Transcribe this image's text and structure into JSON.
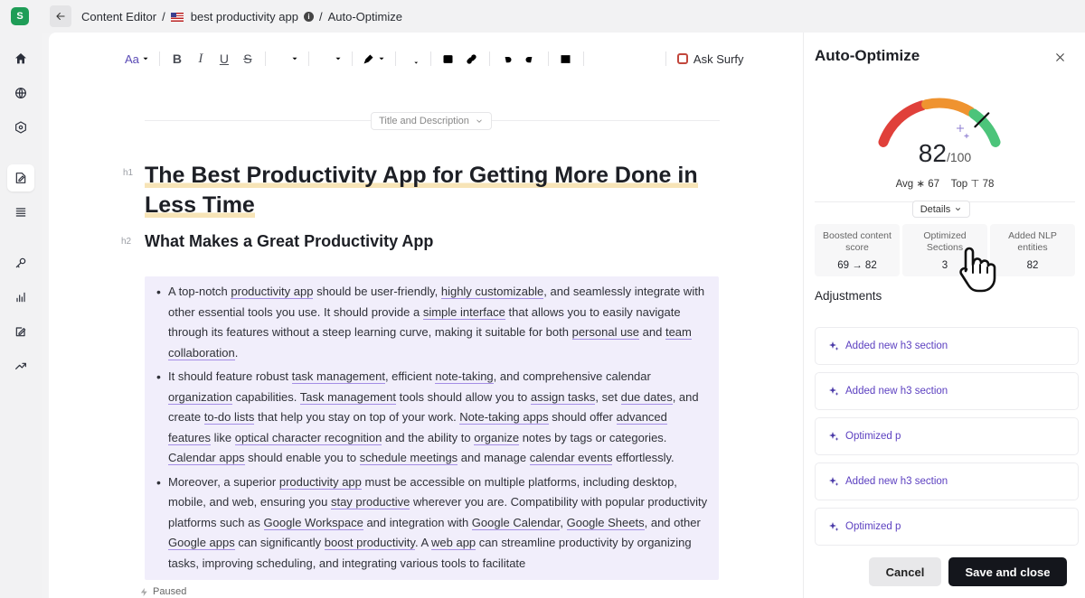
{
  "app": {
    "logo_letter": "S",
    "accent": "#1f9d57"
  },
  "breadcrumb": {
    "root": "Content Editor",
    "sep": "/",
    "doc": "best productivity app",
    "page": "Auto-Optimize"
  },
  "toolbar": {
    "text_style": "Aa",
    "ask_surfy": "Ask Surfy"
  },
  "editor": {
    "title_desc_button": "Title and Description",
    "h1_tag": "h1",
    "h1": "The Best Productivity App for Getting More Done in Less Time",
    "h2_tag": "h2",
    "h2": "What Makes a Great Productivity App",
    "status": "Paused",
    "bullets": [
      [
        {
          "t": "A top-notch "
        },
        {
          "t": "productivity app",
          "u": true
        },
        {
          "t": " should be user-friendly, "
        },
        {
          "t": "highly customizable",
          "u": true
        },
        {
          "t": ", and seamlessly integrate with other essential tools you use. It should provide a "
        },
        {
          "t": "simple interface",
          "u": true
        },
        {
          "t": " that allows you to easily navigate through its features without a steep learning curve, making it suitable for both "
        },
        {
          "t": "personal use",
          "u": true
        },
        {
          "t": " and "
        },
        {
          "t": "team collaboration",
          "u": true
        },
        {
          "t": "."
        }
      ],
      [
        {
          "t": "It should feature robust "
        },
        {
          "t": "task management",
          "u": true
        },
        {
          "t": ", efficient "
        },
        {
          "t": "note-taking",
          "u": true
        },
        {
          "t": ", and comprehensive calendar "
        },
        {
          "t": "organization",
          "u": true
        },
        {
          "t": " capabilities. "
        },
        {
          "t": "Task management",
          "u": true
        },
        {
          "t": " tools should allow you to "
        },
        {
          "t": "assign tasks",
          "u": true
        },
        {
          "t": ", set "
        },
        {
          "t": "due dates",
          "u": true
        },
        {
          "t": ", and create "
        },
        {
          "t": "to-do lists",
          "u": true
        },
        {
          "t": " that help you stay on top of your work. "
        },
        {
          "t": "Note-taking apps",
          "u": true
        },
        {
          "t": " should offer "
        },
        {
          "t": "advanced features",
          "u": true
        },
        {
          "t": " like "
        },
        {
          "t": "optical character recognition",
          "u": true
        },
        {
          "t": " and the ability to "
        },
        {
          "t": "organize",
          "u": true
        },
        {
          "t": " notes by tags or categories. "
        },
        {
          "t": "Calendar apps",
          "u": true
        },
        {
          "t": " should enable you to "
        },
        {
          "t": "schedule meetings",
          "u": true
        },
        {
          "t": " and manage "
        },
        {
          "t": "calendar events",
          "u": true
        },
        {
          "t": " effortlessly."
        }
      ],
      [
        {
          "t": "Moreover, a superior "
        },
        {
          "t": "productivity app",
          "u": true
        },
        {
          "t": " must be accessible on multiple platforms, including desktop, mobile, and web, ensuring you "
        },
        {
          "t": "stay productive",
          "u": true
        },
        {
          "t": " wherever you are. Compatibility with popular productivity platforms such as "
        },
        {
          "t": "Google Workspace",
          "u": true
        },
        {
          "t": " and integration with "
        },
        {
          "t": "Google Calendar",
          "u": true
        },
        {
          "t": ", "
        },
        {
          "t": "Google Sheets",
          "u": true
        },
        {
          "t": ", and other "
        },
        {
          "t": "Google apps",
          "u": true
        },
        {
          "t": " can significantly "
        },
        {
          "t": "boost productivity",
          "u": true
        },
        {
          "t": ". A "
        },
        {
          "t": "web app",
          "u": true
        },
        {
          "t": " can streamline productivity by organizing tasks, improving scheduling, and integrating various tools to facilitate"
        }
      ]
    ]
  },
  "panel": {
    "title": "Auto-Optimize",
    "score": {
      "value": "82",
      "max": "/100",
      "avg_label": "Avg",
      "avg": "67",
      "top_label": "Top",
      "top": "78",
      "fraction": 0.82
    },
    "details_button": "Details",
    "stats": [
      {
        "label": "Boosted content score",
        "value": "69 → 82"
      },
      {
        "label": "Optimized Sections",
        "value": "3"
      },
      {
        "label": "Added NLP entities",
        "value": "82"
      }
    ],
    "adjustments_title": "Adjustments",
    "adjustments": [
      "Added new h3 section",
      "Added new h3 section",
      "Optimized p",
      "Added new h3 section",
      "Optimized p"
    ],
    "cancel": "Cancel",
    "save": "Save and close"
  },
  "colors": {
    "gauge_red": "#e0403a",
    "gauge_orange": "#ef9330",
    "gauge_green": "#4cc47a",
    "underline": "#a58ee6",
    "highlight": "#f1eefb"
  }
}
